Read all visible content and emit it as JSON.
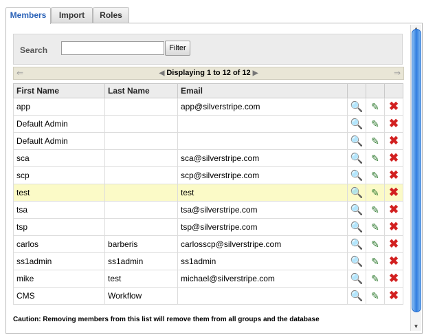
{
  "tabs": [
    {
      "label": "Members",
      "active": true
    },
    {
      "label": "Import",
      "active": false
    },
    {
      "label": "Roles",
      "active": false
    }
  ],
  "search": {
    "label": "Search",
    "value": "",
    "placeholder": "",
    "filter_label": "Filter"
  },
  "pager": {
    "first_icon": "first-page-icon",
    "prev_icon": "prev-page-icon",
    "next_icon": "next-page-icon",
    "last_icon": "last-page-icon",
    "text": "Displaying 1 to 12 of 12"
  },
  "table": {
    "columns": [
      "First Name",
      "Last Name",
      "Email"
    ],
    "rows": [
      {
        "first": "app",
        "last": "",
        "email": "app@silverstripe.com"
      },
      {
        "first": "Default Admin",
        "last": "",
        "email": ""
      },
      {
        "first": "Default Admin",
        "last": "",
        "email": ""
      },
      {
        "first": "sca",
        "last": "",
        "email": "sca@silverstripe.com"
      },
      {
        "first": "scp",
        "last": "",
        "email": "scp@silverstripe.com"
      },
      {
        "first": "test",
        "last": "",
        "email": "test",
        "highlight": true
      },
      {
        "first": "tsa",
        "last": "",
        "email": "tsa@silverstripe.com"
      },
      {
        "first": "tsp",
        "last": "",
        "email": "tsp@silverstripe.com"
      },
      {
        "first": "carlos",
        "last": "barberis",
        "email": "carlosscp@silverstripe.com"
      },
      {
        "first": "ss1admin",
        "last": "ss1admin",
        "email": "ss1admin"
      },
      {
        "first": "mike",
        "last": "test",
        "email": "michael@silverstripe.com"
      },
      {
        "first": "CMS",
        "last": "Workflow",
        "email": ""
      }
    ],
    "row_actions": {
      "view_icon": "magnifier-icon",
      "edit_icon": "edit-icon",
      "delete_icon": "delete-icon"
    }
  },
  "caution": "Caution: Removing members from this list will remove them from all groups and the database",
  "colors": {
    "accent": "#2a62b8",
    "highlight_row": "#fbfac7",
    "delete": "#d22020"
  }
}
